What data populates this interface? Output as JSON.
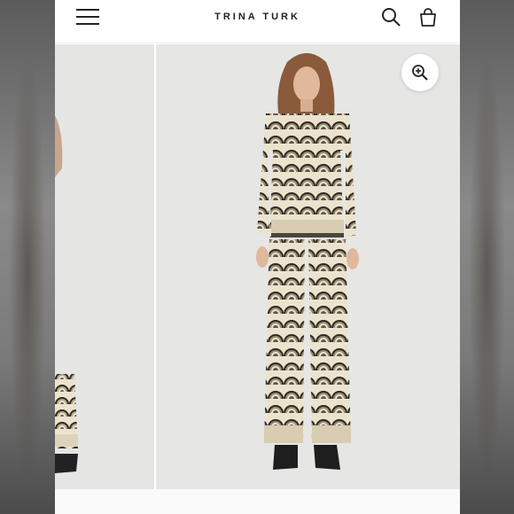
{
  "header": {
    "brand": "TRINA TURK",
    "icons": {
      "menu": "hamburger-menu-icon",
      "search": "search-icon",
      "bag": "shopping-bag-icon"
    }
  },
  "gallery": {
    "zoom_icon": "zoom-in-icon"
  },
  "colors": {
    "page_bg": "#ffffff",
    "photo_bg": "#e6e6e4",
    "text": "#222222",
    "pattern_dark": "#2b2a24",
    "pattern_tan": "#b8a88a",
    "pattern_cream": "#ece3cf"
  }
}
